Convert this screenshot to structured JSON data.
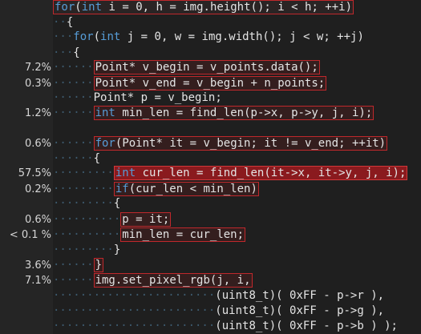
{
  "colors": {
    "background": "#1e1e1e",
    "keyword": "#569cd6",
    "text": "#e4e4e4",
    "hot_border": "#c0282c",
    "hot_fill": "#8a1a1e",
    "whitespace_dots": "#3d5a6e"
  },
  "lines": [
    {
      "pct": "",
      "indent": "",
      "code": "for(int i = 0, h = img.height(); i < h; ++i)"
    },
    {
      "pct": "",
      "indent": "··",
      "code": "{"
    },
    {
      "pct": "",
      "indent": "···",
      "code": "for(int j = 0, w = img.width(); j < w; ++j)"
    },
    {
      "pct": "",
      "indent": "···",
      "code": "{"
    },
    {
      "pct": "7.2%",
      "indent": "······",
      "code": "Point* v_begin = v_points.data();"
    },
    {
      "pct": "0.3%",
      "indent": "······",
      "code": "Point* v_end = v_begin + n_points;"
    },
    {
      "pct": "",
      "indent": "······",
      "code": "Point* p = v_begin;"
    },
    {
      "pct": "1.2%",
      "indent": "······",
      "code": "int min_len = find_len(p->x, p->y, j, i);"
    },
    {
      "pct": "",
      "indent": "",
      "code": ""
    },
    {
      "pct": "0.6%",
      "indent": "······",
      "code": "for(Point* it = v_begin; it != v_end; ++it)"
    },
    {
      "pct": "",
      "indent": "······",
      "code": "{"
    },
    {
      "pct": "57.5%",
      "indent": "·········",
      "code": "int cur_len = find_len(it->x, it->y, j, i);"
    },
    {
      "pct": "0.2%",
      "indent": "·········",
      "code": "if(cur_len < min_len)"
    },
    {
      "pct": "",
      "indent": "·········",
      "code": "{"
    },
    {
      "pct": "0.6%",
      "indent": "··········",
      "code": "p = it;"
    },
    {
      "pct": "< 0.1 %",
      "indent": "··········",
      "code": "min_len = cur_len;"
    },
    {
      "pct": "",
      "indent": "·········",
      "code": "}"
    },
    {
      "pct": "3.6%",
      "indent": "······",
      "code": "}"
    },
    {
      "pct": "7.1%",
      "indent": "······",
      "code": "img.set_pixel_rgb(j, i,"
    },
    {
      "pct": "",
      "indent": "························",
      "code": "(uint8_t)( 0xFF - p->r ),"
    },
    {
      "pct": "",
      "indent": "························",
      "code": "(uint8_t)( 0xFF - p->g ),"
    },
    {
      "pct": "",
      "indent": "························",
      "code": "(uint8_t)( 0xFF - p->b ) );"
    }
  ]
}
